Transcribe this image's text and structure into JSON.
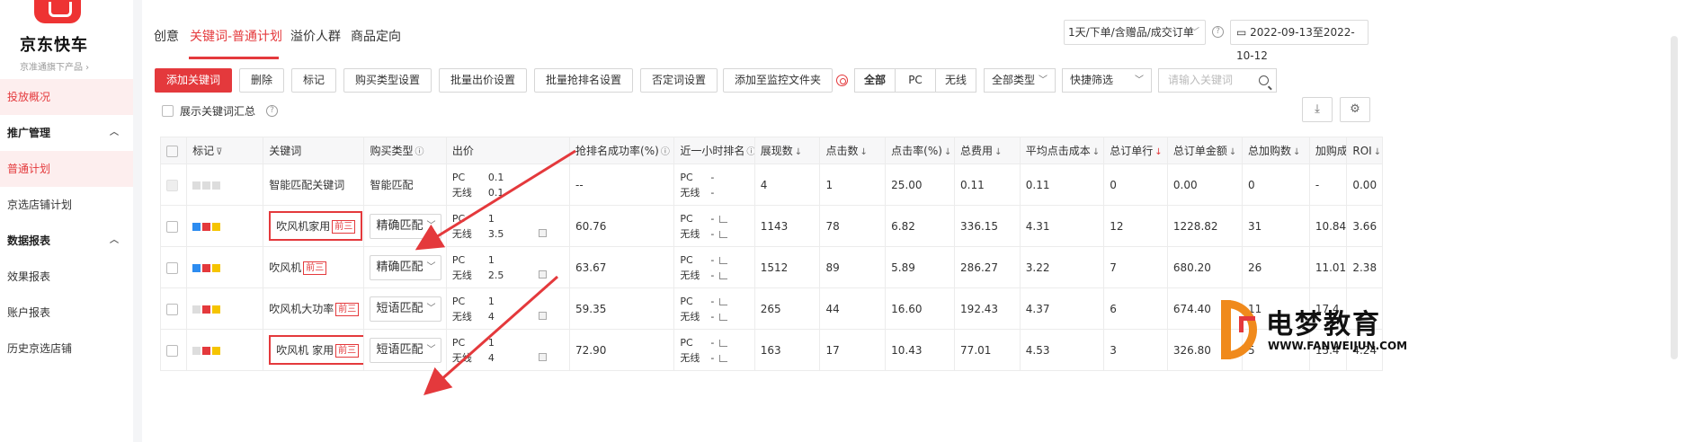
{
  "sidebar": {
    "brand": "京东快车",
    "brand_sub": "京准通旗下产品 ›",
    "items": [
      {
        "label": "投放概况",
        "type": "item",
        "active": true
      },
      {
        "label": "推广管理",
        "type": "group"
      },
      {
        "label": "普通计划",
        "type": "item",
        "active": true
      },
      {
        "label": "京选店铺计划",
        "type": "item"
      },
      {
        "label": "数据报表",
        "type": "group"
      },
      {
        "label": "效果报表",
        "type": "item"
      },
      {
        "label": "账户报表",
        "type": "item"
      },
      {
        "label": "历史京选店铺",
        "type": "item"
      }
    ]
  },
  "top_tabs": [
    "创意",
    "关键词-普通计划",
    "溢价人群",
    "商品定向"
  ],
  "active_tab": "关键词-普通计划",
  "range_select": "1天/下单/含赠品/成交订单",
  "date_range": "2022-09-13至2022-10-12",
  "toolbar": {
    "add": "添加关键词",
    "delete": "删除",
    "mark": "标记",
    "buy_type": "购买类型设置",
    "batch_bid": "批量出价设置",
    "batch_rank": "批量抢排名设置",
    "negative": "否定词设置",
    "monitor": "添加至监控文件夹",
    "seg_all": "全部",
    "seg_pc": "PC",
    "seg_wireless": "无线",
    "type_filter": "全部类型",
    "quick_filter": "快捷筛选",
    "search_placeholder": "请输入关键词"
  },
  "summary_label": "展示关键词汇总",
  "columns": [
    "标记",
    "关键词",
    "购买类型",
    "出价",
    "抢排名成功率(%)",
    "近一小时排名",
    "展现数",
    "点击数",
    "点击率(%)",
    "总费用",
    "平均点击成本",
    "总订单行",
    "总订单金额",
    "总加购数",
    "加购成本",
    "ROI"
  ],
  "rows": [
    {
      "keyword": "智能匹配关键词",
      "tag": "",
      "match": "智能匹配",
      "pc_bid": "0.1",
      "wl_bid": "0.1",
      "rank_rate": "--",
      "pc_rank": "-",
      "wl_rank": "-",
      "impr": "4",
      "clicks": "1",
      "ctr": "25.00",
      "cost": "0.11",
      "cpc": "0.11",
      "orders": "0",
      "order_amt": "0.00",
      "carts": "0",
      "cart_cost": "-",
      "roi": "0.00",
      "marks": [
        "#ddd",
        "#ddd",
        "#ddd"
      ],
      "disabled": true,
      "boxed": false
    },
    {
      "keyword": "吹风机家用",
      "tag": "前三",
      "match": "精确匹配",
      "pc_bid": "1",
      "wl_bid": "3.5",
      "rank_rate": "60.76",
      "pc_rank": "-",
      "wl_rank": "-",
      "impr": "1143",
      "clicks": "78",
      "ctr": "6.82",
      "cost": "336.15",
      "cpc": "4.31",
      "orders": "12",
      "order_amt": "1228.82",
      "carts": "31",
      "cart_cost": "10.84",
      "roi": "3.66",
      "marks": [
        "#2d8cf0",
        "#e4393c",
        "#f5c400"
      ],
      "disabled": false,
      "boxed": true
    },
    {
      "keyword": "吹风机",
      "tag": "前三",
      "match": "精确匹配",
      "pc_bid": "1",
      "wl_bid": "2.5",
      "rank_rate": "63.67",
      "pc_rank": "-",
      "wl_rank": "-",
      "impr": "1512",
      "clicks": "89",
      "ctr": "5.89",
      "cost": "286.27",
      "cpc": "3.22",
      "orders": "7",
      "order_amt": "680.20",
      "carts": "26",
      "cart_cost": "11.01",
      "roi": "2.38",
      "marks": [
        "#2d8cf0",
        "#e4393c",
        "#f5c400"
      ],
      "disabled": false,
      "boxed": false
    },
    {
      "keyword": "吹风机大功率",
      "tag": "前三",
      "match": "短语匹配",
      "pc_bid": "1",
      "wl_bid": "4",
      "rank_rate": "59.35",
      "pc_rank": "-",
      "wl_rank": "-",
      "impr": "265",
      "clicks": "44",
      "ctr": "16.60",
      "cost": "192.43",
      "cpc": "4.37",
      "orders": "6",
      "order_amt": "674.40",
      "carts": "11",
      "cart_cost": "17.4",
      "roi": "",
      "marks": [
        "#ddd",
        "#e4393c",
        "#f5c400"
      ],
      "disabled": false,
      "boxed": false
    },
    {
      "keyword": "吹风机 家用",
      "tag": "前三",
      "match": "短语匹配",
      "pc_bid": "1",
      "wl_bid": "4",
      "rank_rate": "72.90",
      "pc_rank": "-",
      "wl_rank": "-",
      "impr": "163",
      "clicks": "17",
      "ctr": "10.43",
      "cost": "77.01",
      "cpc": "4.53",
      "orders": "3",
      "order_amt": "326.80",
      "carts": "5",
      "cart_cost": "15.4",
      "roi": "4.24",
      "marks": [
        "#ddd",
        "#e4393c",
        "#f5c400"
      ],
      "disabled": false,
      "boxed": true
    }
  ],
  "bid_labels": {
    "pc": "PC",
    "wireless": "无线"
  },
  "watermark": {
    "title": "电梦教育",
    "url": "WWW.FANWEIJUN.COM"
  }
}
